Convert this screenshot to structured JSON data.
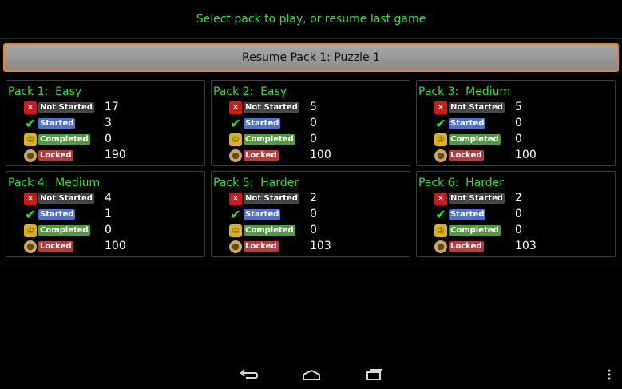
{
  "header": {
    "prompt": "Select pack to play, or resume last game"
  },
  "resume": {
    "label": "Resume Pack 1: Puzzle 1"
  },
  "labels": {
    "not_started": "Not Started",
    "started": "Started",
    "completed": "Completed",
    "locked": "Locked"
  },
  "icons": {
    "not_started": "x-icon",
    "started": "checkmark-icon",
    "completed": "trophy-icon",
    "locked": "lock-icon"
  },
  "packs": [
    {
      "title": "Pack 1:  Easy",
      "not_started": "17",
      "started": "3",
      "completed": "0",
      "locked": "190"
    },
    {
      "title": "Pack 2:  Easy",
      "not_started": "5",
      "started": "0",
      "completed": "0",
      "locked": "100"
    },
    {
      "title": "Pack 3:  Medium",
      "not_started": "5",
      "started": "0",
      "completed": "0",
      "locked": "100"
    },
    {
      "title": "Pack 4:  Medium",
      "not_started": "4",
      "started": "1",
      "completed": "0",
      "locked": "100"
    },
    {
      "title": "Pack 5:  Harder",
      "not_started": "2",
      "started": "0",
      "completed": "0",
      "locked": "103"
    },
    {
      "title": "Pack 6:  Harder",
      "not_started": "2",
      "started": "0",
      "completed": "0",
      "locked": "103"
    }
  ],
  "colors": {
    "accent_green": "#2ee03a",
    "resume_border": "#e08a1a"
  }
}
